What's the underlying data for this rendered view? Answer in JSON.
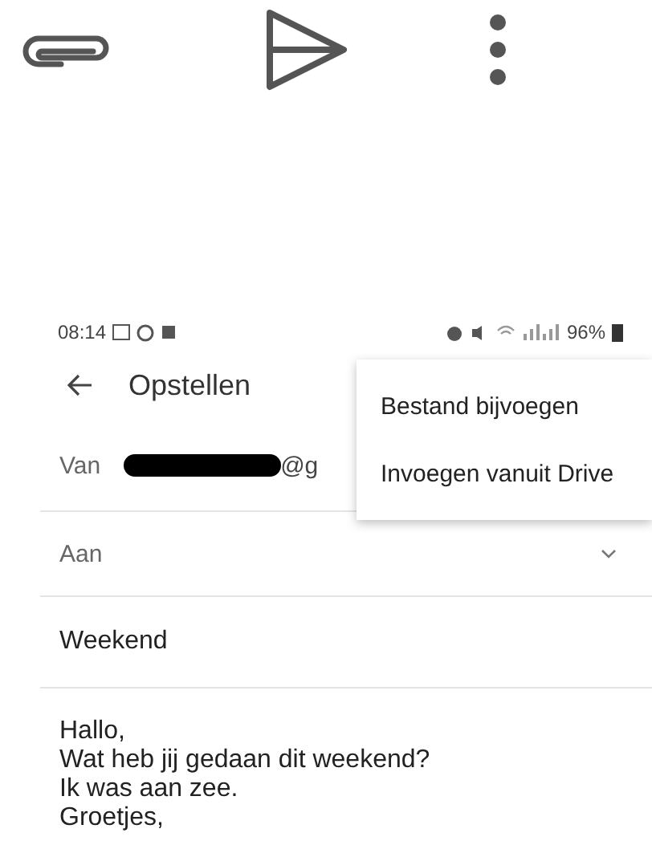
{
  "status_bar": {
    "time": "08:14",
    "battery": "96%"
  },
  "header": {
    "title": "Opstellen"
  },
  "from": {
    "label": "Van",
    "value": "@g"
  },
  "to": {
    "label": "Aan"
  },
  "subject": {
    "value": "Weekend"
  },
  "body": {
    "lines": [
      "Hallo,",
      "Wat heb jij gedaan dit weekend?",
      "Ik was aan zee.",
      "Groetjes,"
    ]
  },
  "menu": {
    "items": [
      "Bestand bijvoegen",
      "Invoegen vanuit Drive"
    ]
  }
}
